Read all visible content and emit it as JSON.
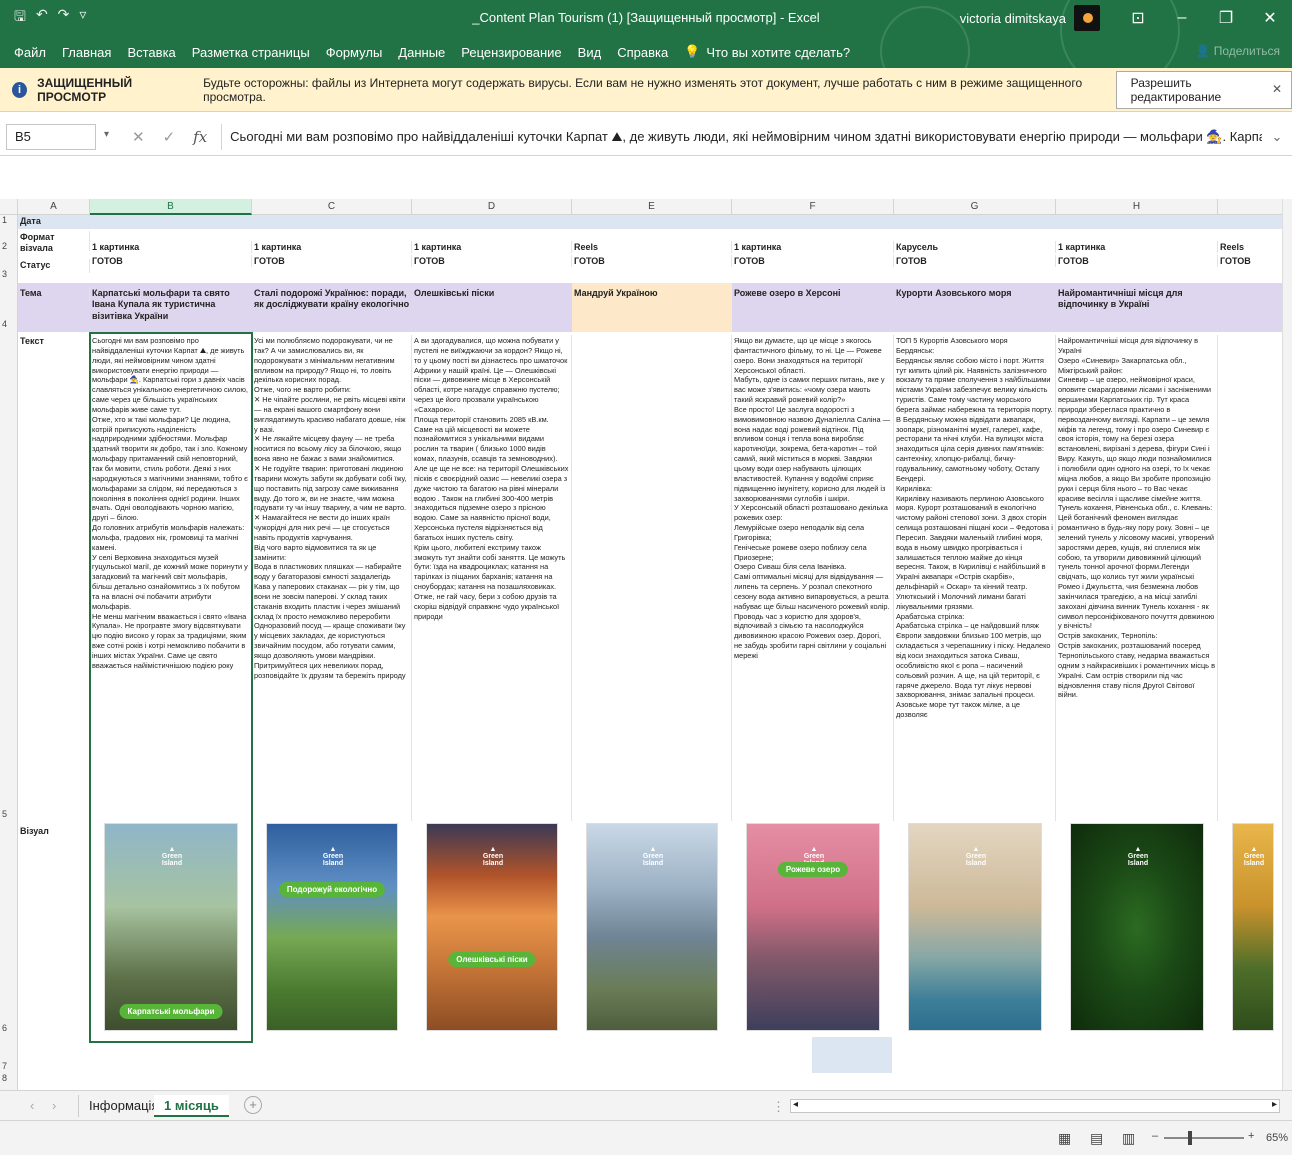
{
  "window": {
    "title": "_Content Plan Tourism (1)  [Защищенный просмотр]  -  Excel",
    "user": "victoria dimitskaya",
    "share": "Поделиться"
  },
  "menu": [
    "Файл",
    "Главная",
    "Вставка",
    "Разметка страницы",
    "Формулы",
    "Данные",
    "Рецензирование",
    "Вид",
    "Справка"
  ],
  "tell_me": "Что вы хотите сделать?",
  "protected_view": {
    "title": "ЗАЩИЩЕННЫЙ ПРОСМОТР",
    "message": "Будьте осторожны: файлы из Интернета могут содержать вирусы. Если вам не нужно изменять этот документ, лучше работать с ним в режиме защищенного просмотра.",
    "button": "Разрешить редактирование"
  },
  "formula_bar": {
    "name_box": "B5",
    "formula": "Сьогодні ми вам розповімо про найвіддаленіші куточки Карпат ⛰, де живуть люди, які неймовірним чином здатні використовувати енергію природи — мольфари 🧙. Карпатські гори з давніх часів"
  },
  "columns": [
    "A",
    "B",
    "C",
    "D",
    "E",
    "F",
    "G",
    "H"
  ],
  "rows": [
    "1",
    "2",
    "3",
    "4",
    "5",
    "6",
    "7",
    "8"
  ],
  "row_labels": {
    "date": "Дата",
    "format": "Формат візуала",
    "status": "Статус",
    "topic": "Тема",
    "text": "Текст",
    "visual": "Візуал"
  },
  "cols": [
    {
      "format": "1 картинка",
      "status": "ГОТОВ",
      "topic": "Карпатські мольфари та свято Івана Купала як туристична візитівка України",
      "text": "Сьогодні ми вам розповімо про найвіддаленіші куточки Карпат ⛰, де живуть люди, які неймовірним чином здатні використовувати енергію природи — мольфари 🧙. Карпатські гори з давніх часів славляться унікальною енергетичною силою, саме через це більшість українських мольфарів живе саме тут.\nОтже, хто ж такі мольфари? Це людина, котрій приписують наділеність надприродними здібностями. Мольфар здатний творити як добро, так і зло. Кожному мольфару притаманний свій неповторний, так би мовити, стиль роботи. Деякі з них народжуються з магічними знаннями, тобто є мольфарами за слідом, які передаються з покоління в покоління однієї родини. Інших вчать. Одні оволодівають чорною магією, другі – білою.\nДо головних атрибутів мольфарів належать: мольфа, градових нік, громовиці та магічні камені.\nУ селі Верховина знаходиться музей гуцульської магії, де кожний може поринути у загадковий та магічний світ мольфарів, більш детально ознайомитись з їх побутом та на власні очі побачити атрибути мольфарів.\nНе менш магічним вважається і свято «Івана Купала». Не програвте змогу відсвяткувати цю подію високо у горах за традиціями, яким вже сотні років і котрі неможливо побачити в інших містах України. Саме це свято вважається найімістичнішою подією року",
      "badge": "Карпатські мольфари",
      "img": "molfar"
    },
    {
      "format": "1 картинка",
      "status": "ГОТОВ",
      "topic": "Сталі подорожі Українює: поради, як досліджувати країну екологічно",
      "text": "Усі ми полюбляємо подорожувати, чи не так? А чи замислювались ви, як подорожувати з мінімальним негативним впливом на природу? Якщо ні, то ловіть декілька корисних порад.\nОтже, чого не варто робити:\n✕ Не чіпайте рослини, не рвіть місцеві квіти — на екрані вашого смартфону вони виглядатимуть красиво набагато довше, ніж у вазі.\n✕ Не лякайте місцеву фауну — не треба носитися по всьому лісу за білочкою, якщо вона явно не бажає з вами знайомитися.\n✕ Не годуйте тварин: приготовані людиною тварини можуть забути як добувати собі їжу, що поставить під загрозу саме виживання виду. До того ж, ви не знаєте, чим можна годувати ту чи іншу тварину, а чим не варто.\n✕ Намагайтеся не вести до інших країн чужорідні для них речі — це стосується навіть продуктів харчування.\nВід чого варто відмовитися та як це замінити:\nВода в пластикових пляшках — набирайте воду у багаторазові ємності заздалегідь\nКава у паперових стаканах — рік у тім, що вони не зовсім паперові. У склад таких стаканів входить пластик і через змішаний склад їх просто неможливо переробити\nОдноразовий посуд — краще споживати їжу у місцевих закладах, де користуються звичайним посудом, або готувати самим, якщо дозволяють умови мандрівки.\nПритримуйтеся цих невеликих порад, розповідайте їх друзям та бережіть природу",
      "badge": "Подорожуй екологічно",
      "img": "mountain"
    },
    {
      "format": "1 картинка",
      "status": "ГОТОВ",
      "topic": "Олешківські піски",
      "text": "А ви здогадувалися, що можна побувати у пустелі не виїжджаючи за кордон? Якщо ні, то у цьому пості ви дізнаєтесь про шматочок Африки у нашій країні. Це — Олешківські піски — дивовижне місце в Херсонській області, котре нагадує справжню пустелю; через це його прозвали українською «Сахарою».\nПлоща території становить 2085 кВ.км. Саме на цій місцевості ви можете познайомитися з унікальними видами рослин та тварин ( близько 1000 видів комах, плазунів, ссавців та земноводних). Але це ще не все: на території Олешківських пісків є своєрідний оазис — невеликі озера з дуже чистою та багатою на рівні мінерали водою . Також на глибині 300-400 метрів знаходиться підземне озеро з прісною водою. Саме за наявністю прісної води, Херсонська пустеля відрізняється від багатьох інших пустель світу.\nКрім цього, любителі екстриму також зможуть тут знайти собі заняття. Це можуть бути: їзда на квадроциклах; катання на тарілках із піщаних барханів; катання на сноубордах; катання на позашляховиках.\nОтже, не гай часу, бери з собою друзів та скоріш відвідуй справжнє чудо української природи",
      "badge": "Олешківські піски",
      "img": "desert"
    },
    {
      "format": "Reels",
      "status": "ГОТОВ",
      "topic": "Мандруй Україною",
      "text": "",
      "badge": "",
      "img": "city"
    },
    {
      "format": "1 картинка",
      "status": "ГОТОВ",
      "topic": "Рожеве озеро в Херсоні",
      "text": "Якщо ви думаєте, що це місце з якогось фантастичного фільму, то ні. Це — Рожеве озеро. Вони знаходяться на території Херсонської області.\nМабуть, одне із самих перших питань, яке у вас може з'явитись: «чому озера мають такий яскравий рожевий колір?»\nВсе просто! Це заслуга водорості з вимовимовною назвою Дуналіелла Саліна — вона надає воді рожевий відтінок. Під впливом сонця і тепла вона виробляє каротиноїди, зокрема, бета-каротин – той самий, який міститься в моркві. Завдяки цьому води озер набувають цілющих властивостей. Купання у водоймі сприяє підвищенню імунітету, корисно для людей із захворюваннями суглобів і шкіри.\nУ Херсонській області розташовано декілька рожевих озер:\nЛемурійське озеро неподалік від села Григорівка;\nГенічеське рожеве озеро поблизу села Приозерне;\nОзеро Сиваш біля села Іванівка.\nСамі оптимальні місяці для відвідування — липень та серпень. У розпал спекотного сезону вода активно випаровується, а решта набуває ще більш насиченого рожевий колір.\nПроводь час з користю для здоров'я, відпочивай з сімьєю та насолоджуйся дивовижною красою Рожевих озер. Дорогі, не забудь зробити гарні світлини у соціальні мережі",
      "badge": "Рожеве озеро",
      "img": "pink"
    },
    {
      "format": "Карусель",
      "status": "ГОТОВ",
      "topic": "Курорти Азовського моря",
      "text": "ТОП 5 Курортів Азовського моря\nБердянськ:\nБердянськ являє собою місто і порт. Життя тут кипить цілий рік. Наявність залізничного вокзалу та пряме сполучення з найбільшими містами України забезпечує велику кількість туристів. Саме тому частину морського берега займає набережна та територія порту. В Бердянську можна відвідати аквапарк, зоопарк, різноманітні музеї, галереї, кафе, ресторани та нічні клуби. На вулицях міста знаходиться ціла серія дивних пам'ятників: сантехніку, хлопцю-рибалці, бичку-годувальнику, самотньому чоботу, Остапу Бендері.\nКирилівка:\nКирилівку називають перлиною Азовського моря. Курорт розташований в екологічно чистому районі степової зони. З двох сторін селища розташовані піщані коси – Федотова і Пересип. Завдяки маленькій глибині моря, вода в ньому швидко прогрівається і залишається теплою майже до кінця вересня. Також, в Кирилівці є найбільший в Україні аквапарк «Острів скарбів», дельфінарій « Оскар» та кінний театр. Улюткський і Молочний лимани багаті лікувальними грязями.\nАрабатська стрілка:\nАрабатська стрілка – це найдовший пляж Європи завдовжки близько 100 метрів, що складається з черепашнику і піску. Недалеко від коси знаходиться затока Сиваш, особливістю якої є ропа – насичений сольовий розчин. А ще, на цій території, є гаряче джерело. Вода тут лікує нервові захворювання, знімає запальні процеси. Азовське море тут також мілке, а це дозволяє",
      "badge": "",
      "img": "sea"
    },
    {
      "format": "1 картинка",
      "status": "ГОТОВ",
      "topic": "Найромантичніші місця для відпочинку в Україні",
      "text": "Найромантичніші місця для відпочинку в Україні\nОзеро «Синевир» Закарпатська обл., Міжгірський район:\nСиневир – це озеро, неймовірної краси, оповите смарагдовими лісами і засніженими вершинами Карпатських гір. Тут краса природи збереглася практично в первозданному вигляді. Карпати – це земля міфів та легенд, тому і про озеро Синевир є своя історія, тому на березі озера встановлені, вирізані з дерева, фігури Сині і Виру. Кажуть, що якщо люди познайомилися і полюбили один одного на озері, то їх чекає міцна любов, а якщо Ви зробите пропозицію руки і серця біля нього – то Вас чекає красиве весілля і щасливе сімейне життя.\nТунель кохання, Рівненська обл., с. Клевань:\nЦей ботанічний феномен виглядає романтично в будь-яку пору року. Зовні – це зелений тунель у лісовому масиві, утворений заростями дерев, кущів, які сплелися між собою, та утворили дивовижний цілющий тунель тонної арочної форми.Легенди свідчать, що колись тут жили українські Ромео і Джульєтта, чия безмежна любов закінчилася трагедією, а на місці загиблі закохані дівчина винник Тунель кохання - як символ персоніфікованого почуття довжиною у вічність!\nОстрів закоханих, Тернопіль:\nОстрів закоханих, розташований посеред Тернопільського ставу, недарма вважається одним з найкрасивіших і романтичних місць в Україні. Сам острів створили під час відновлення ставу після Другої Світової війни.",
      "badge": "",
      "img": "forest"
    },
    {
      "format": "Reels",
      "status": "ГОТОВ",
      "topic": "",
      "text": "",
      "badge": "",
      "img": "sunflower"
    }
  ],
  "logo_text": "Green Island",
  "sheets": [
    "Інформація",
    "1 місяць"
  ],
  "active_sheet": "1 місяць",
  "zoom": "65%"
}
